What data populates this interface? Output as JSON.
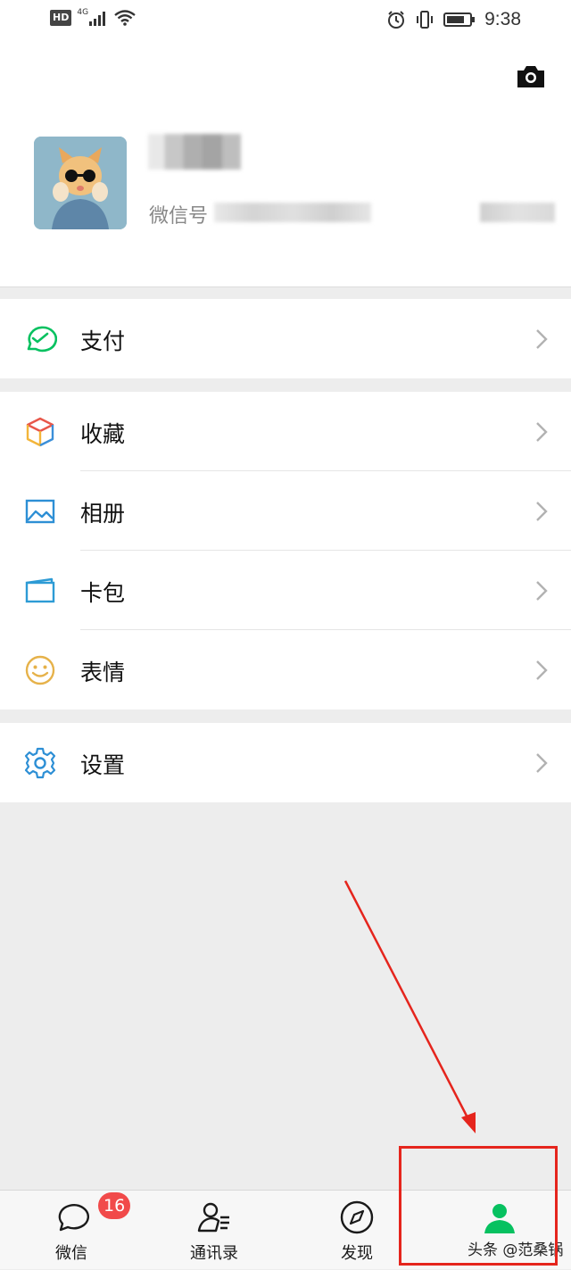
{
  "status_bar": {
    "hd": "HD",
    "network": "4G",
    "time": "9:38"
  },
  "profile": {
    "wechat_id_label": "微信号"
  },
  "menu": {
    "pay": "支付",
    "favorites": "收藏",
    "album": "相册",
    "cards": "卡包",
    "stickers": "表情",
    "settings": "设置"
  },
  "tabbar": {
    "chats": "微信",
    "chats_badge": "16",
    "contacts": "通讯录",
    "discover": "发现"
  },
  "watermark": "头条 @范桑锅",
  "colors": {
    "wechat_green": "#07c160",
    "badge_red": "#f14a4a",
    "annotation_red": "#e5251d"
  }
}
